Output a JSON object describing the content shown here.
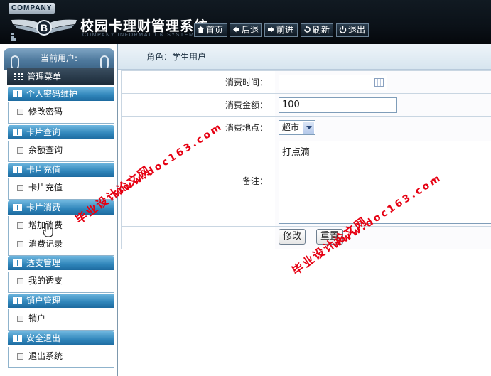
{
  "header": {
    "company": "COMPANY",
    "title": "校园卡理财管理系统",
    "subtitle": "COMPANY INFORMATION SYSTEM",
    "nav": [
      {
        "label": "首页",
        "icon": "home-icon"
      },
      {
        "label": "后退",
        "icon": "arrow-left-icon"
      },
      {
        "label": "前进",
        "icon": "arrow-right-icon"
      },
      {
        "label": "刷新",
        "icon": "refresh-icon"
      },
      {
        "label": "退出",
        "icon": "power-icon"
      }
    ]
  },
  "sidebar": {
    "user_label": "当前用户:",
    "menu_label": "管理菜单",
    "groups": [
      {
        "title": "个人密码维护",
        "items": [
          "修改密码"
        ]
      },
      {
        "title": "卡片查询",
        "items": [
          "余额查询"
        ]
      },
      {
        "title": "卡片充值",
        "items": [
          "卡片充值"
        ]
      },
      {
        "title": "卡片消费",
        "items": [
          "增加消费",
          "消费记录"
        ]
      },
      {
        "title": "透支管理",
        "items": [
          "我的透支"
        ]
      },
      {
        "title": "销户管理",
        "items": [
          "销户"
        ]
      },
      {
        "title": "安全退出",
        "items": [
          "退出系统"
        ]
      }
    ]
  },
  "main": {
    "role": "角色：学生用户",
    "form": {
      "time_label": "消费时间：",
      "time_value": "",
      "amount_label": "消费金额：",
      "amount_value": "100",
      "place_label": "消费地点：",
      "place_value": "超市",
      "note_label": "备注：",
      "note_value": "打点滴",
      "submit_label": "修改",
      "reset_label": "重置"
    }
  },
  "watermarks": {
    "url": "www.doc163.com",
    "site": "毕业设计论文网"
  },
  "colors": {
    "header_bg": "#0b1118",
    "accent_blue": "#2f85ba",
    "watermark_red": "#e60012"
  }
}
